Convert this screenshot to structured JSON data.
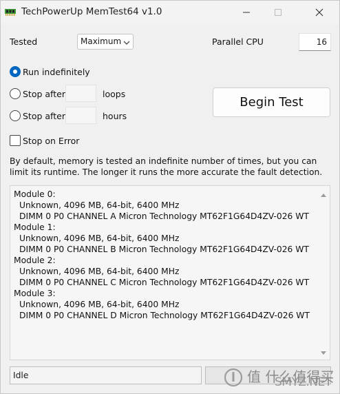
{
  "window": {
    "title": "TechPowerUp MemTest64 v1.0"
  },
  "tested": {
    "label": "Tested",
    "selected": "Maximum"
  },
  "parallel_cpu": {
    "label": "Parallel CPU",
    "value": "16"
  },
  "run_options": {
    "run_indefinitely": "Run indefinitely",
    "stop_after_loops_prefix": "Stop after",
    "loops_unit": "loops",
    "stop_after_hours_prefix": "Stop after",
    "hours_unit": "hours",
    "selected": "run_indefinitely"
  },
  "begin_button": "Begin Test",
  "stop_on_error": {
    "label": "Stop on Error",
    "checked": false
  },
  "description": "By default, memory is tested an indefinite number of times, but you can limit its runtime. The longer it runs the more accurate the fault detection.",
  "log_lines": [
    "Module 0:",
    "Unknown, 4096 MB, 64-bit, 6400 MHz",
    "DIMM 0 P0 CHANNEL A Micron Technology MT62F1G64D4ZV-026 WT",
    "Module 1:",
    "Unknown, 4096 MB, 64-bit, 6400 MHz",
    "DIMM 0 P0 CHANNEL B Micron Technology MT62F1G64D4ZV-026 WT",
    "Module 2:",
    "Unknown, 4096 MB, 64-bit, 6400 MHz",
    "DIMM 0 P0 CHANNEL C Micron Technology MT62F1G64D4ZV-026 WT",
    "Module 3:",
    "Unknown, 4096 MB, 64-bit, 6400 MHz",
    "DIMM 0 P0 CHANNEL D Micron Technology MT62F1G64D4ZV-026 WT"
  ],
  "status": {
    "text": "Idle",
    "progress": 0
  },
  "watermark": {
    "text": "值 什么值得买",
    "url": "SMYZ.NET"
  },
  "colors": {
    "accent": "#0067c0",
    "progress": "#06b025"
  }
}
